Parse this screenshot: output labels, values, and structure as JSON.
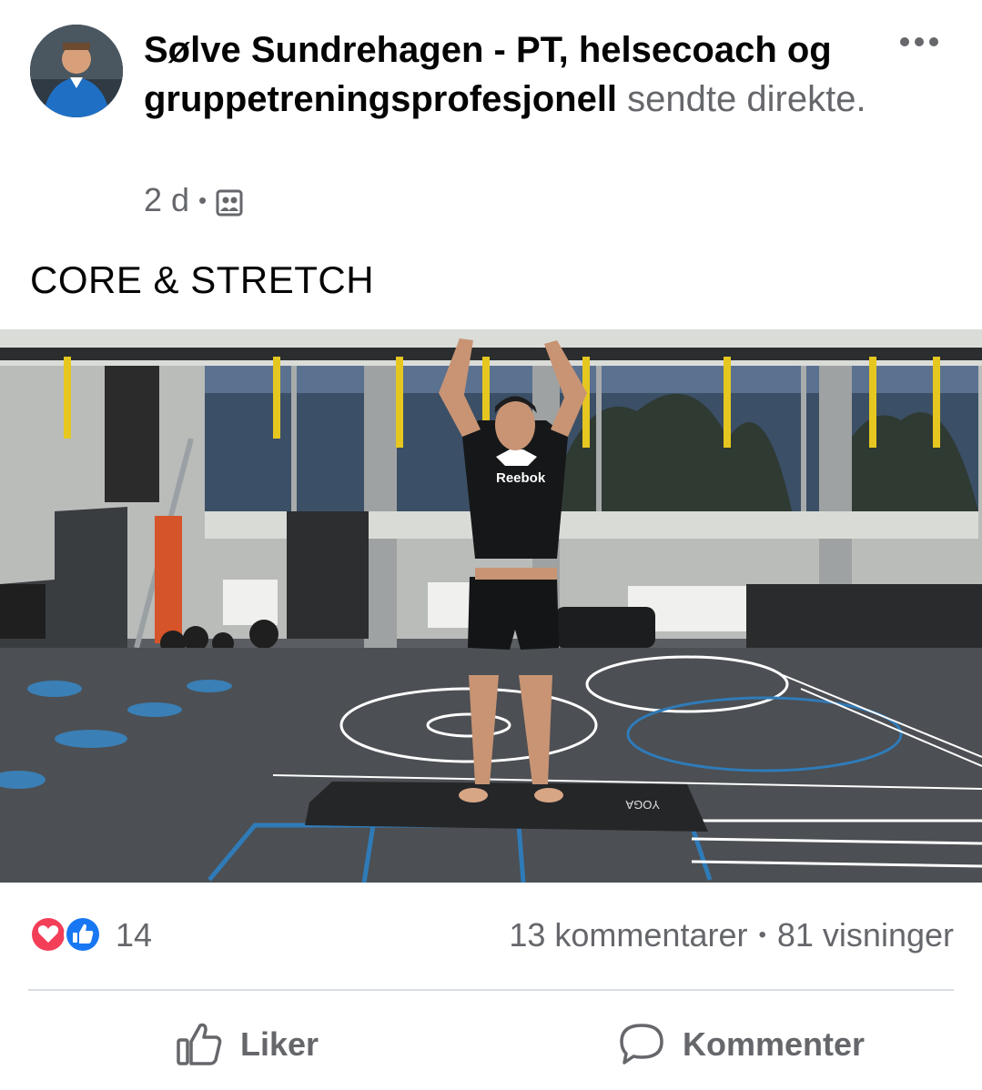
{
  "post": {
    "author_name": "Sølve Sundrehagen - PT, helsecoach og gruppetreningsprofesjonell",
    "action_text": "sendte direkte.",
    "time": "2 d",
    "meta_separator": "•",
    "audience_icon": "group-icon",
    "more_icon": "more-horizontal-icon",
    "text": "CORE & STRETCH"
  },
  "video": {
    "description_icon": "live-video",
    "shirt_brand": "Reebok",
    "mat_brand": "YOGA"
  },
  "stats": {
    "reaction_count": "14",
    "reactions": [
      "love",
      "like"
    ],
    "comments": "13 kommentarer",
    "separator": "•",
    "views": "81 visninger"
  },
  "actions": {
    "like_label": "Liker",
    "comment_label": "Kommenter"
  },
  "colors": {
    "love": "#f33e58",
    "like": "#1877f2",
    "secondary_text": "#65676b",
    "divider": "#dadde1"
  }
}
